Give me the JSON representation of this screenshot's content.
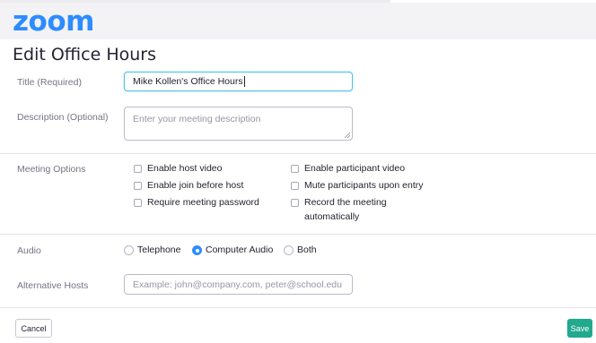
{
  "app": {
    "logo_text": "zoom"
  },
  "page": {
    "title": "Edit Office Hours"
  },
  "form": {
    "title": {
      "label": "Title (Required)",
      "value": "Mike Kollen's Office Hours"
    },
    "description": {
      "label": "Description (Optional)",
      "placeholder": "Enter your meeting description",
      "value": ""
    },
    "meeting_options": {
      "label": "Meeting Options",
      "options": [
        {
          "label": "Enable host video",
          "checked": false
        },
        {
          "label": "Enable participant video",
          "checked": false
        },
        {
          "label": "Enable join before host",
          "checked": false
        },
        {
          "label": "Mute participants upon entry",
          "checked": false
        },
        {
          "label": "Require meeting password",
          "checked": false
        },
        {
          "label": "Record the meeting",
          "label_line2": "automatically",
          "checked": false
        }
      ]
    },
    "audio": {
      "label": "Audio",
      "options": [
        {
          "label": "Telephone",
          "selected": false
        },
        {
          "label": "Computer Audio",
          "selected": true
        },
        {
          "label": "Both",
          "selected": false
        }
      ]
    },
    "alternative_hosts": {
      "label": "Alternative Hosts",
      "placeholder": "Example: john@company.com, peter@school.edu",
      "value": ""
    }
  },
  "footer": {
    "cancel_label": "Cancel",
    "save_label": "Save"
  },
  "colors": {
    "brand": "#2d8cff",
    "save": "#23a98d",
    "focus": "#4fc3e8"
  }
}
